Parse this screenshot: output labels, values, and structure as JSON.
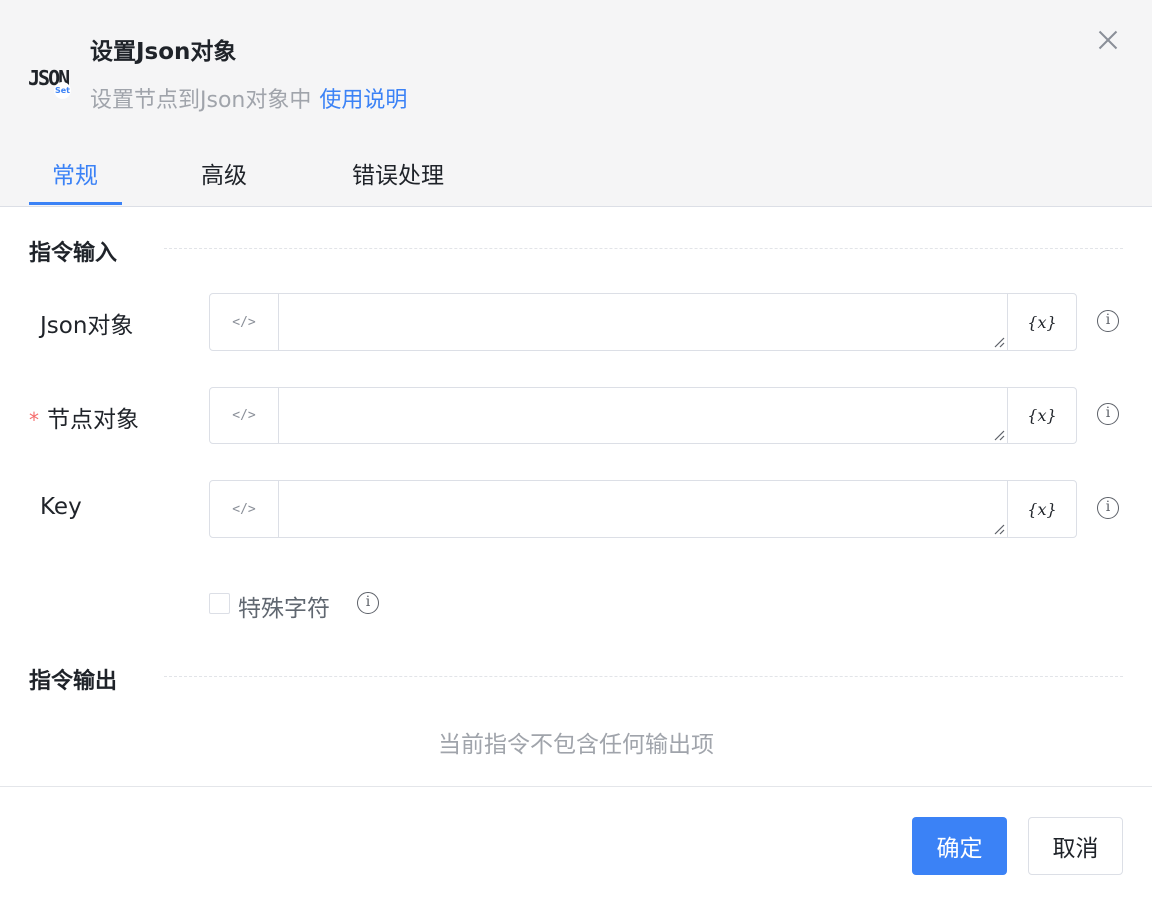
{
  "dialog": {
    "logo_text": "JSON",
    "logo_badge": "Set",
    "title": "设置Json对象",
    "subtitle": "设置节点到Json对象中",
    "help_link": "使用说明"
  },
  "tabs": [
    {
      "label": "常规",
      "active": true
    },
    {
      "label": "高级",
      "active": false
    },
    {
      "label": "错误处理",
      "active": false
    }
  ],
  "input_section": {
    "title": "指令输入",
    "fields": [
      {
        "label": "Json对象",
        "required": false,
        "value": "",
        "code_icon": "</>",
        "var_icon": "{x}"
      },
      {
        "label": "节点对象",
        "required": true,
        "value": "",
        "code_icon": "</>",
        "var_icon": "{x}"
      },
      {
        "label": "Key",
        "required": false,
        "value": "",
        "code_icon": "</>",
        "var_icon": "{x}"
      }
    ],
    "checkbox": {
      "label": "特殊字符",
      "checked": false
    }
  },
  "output_section": {
    "title": "指令输出",
    "empty_text": "当前指令不包含任何输出项"
  },
  "footer": {
    "confirm_label": "确定",
    "cancel_label": "取消"
  },
  "colors": {
    "accent": "#3b82f6",
    "required": "#f56c6c",
    "header_bg": "#f5f5f6"
  }
}
